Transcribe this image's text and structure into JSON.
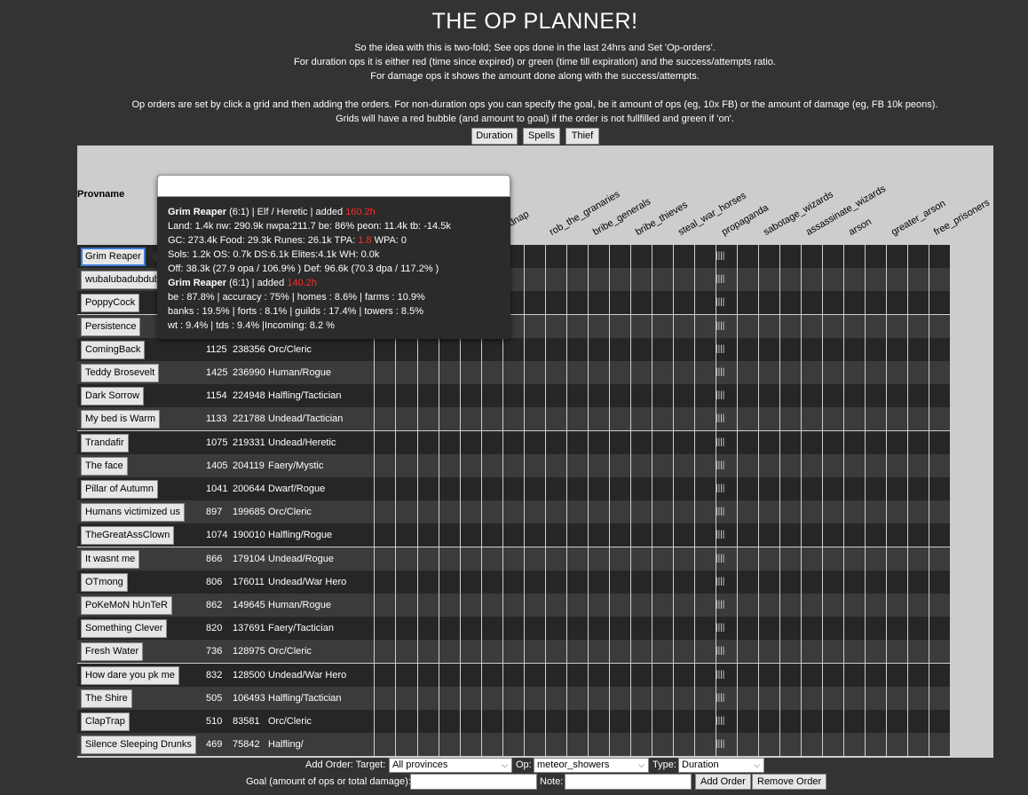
{
  "page": {
    "title": "THE OP PLANNER!",
    "intro": [
      "So the idea with this is two-fold; See ops done in the last 24hrs and Set 'Op-orders'.",
      "For duration ops it is either red (time since expired) or green (time till expiration) and the success/attempts ratio.",
      "For damage ops it shows the amount done along with the success/attempts.",
      "Op orders are set by click a grid and then adding the orders. For non-duration ops you can specify the goal, be it amount of ops (eg, 10x FB) or the amount of damage (eg, FB 10k peons).",
      "Grids will have a red bubble (and amount to goal) if the order is not fullfilled and green if 'on'."
    ]
  },
  "mode_buttons": [
    "Duration",
    "Spells",
    "Thief"
  ],
  "grid": {
    "provname_header": "Provname",
    "ops_columns": [
      "kidnap",
      "rob_the_granaries",
      "bribe_generals",
      "bribe_thieves",
      "steal_war_horses",
      "propaganda",
      "sabotage_wizards",
      "assassinate_wizards",
      "arson",
      "greater_arson",
      "free_prisoners"
    ],
    "tick_mark": "||||",
    "rows": [
      {
        "name": "Grim Reaper",
        "acres": "",
        "nw": "",
        "race_class": ""
      },
      {
        "name": "wubalubadubdub",
        "acres": "",
        "nw": "",
        "race_class": ""
      },
      {
        "name": "PoppyCock",
        "acres": "",
        "nw": "",
        "race_class": ""
      },
      {
        "name": "Persistence",
        "acres": "",
        "nw": "",
        "race_class": ""
      },
      {
        "name": "ComingBack",
        "acres": "1125",
        "nw": "238356",
        "race_class": "Orc/Cleric"
      },
      {
        "name": "Teddy Brosevelt",
        "acres": "1425",
        "nw": "236990",
        "race_class": "Human/Rogue"
      },
      {
        "name": "Dark Sorrow",
        "acres": "1154",
        "nw": "224948",
        "race_class": "Halfling/Tactician"
      },
      {
        "name": "My bed is Warm",
        "acres": "1133",
        "nw": "221788",
        "race_class": "Undead/Tactician"
      },
      {
        "name": "Trandafir",
        "acres": "1075",
        "nw": "219331",
        "race_class": "Undead/Heretic"
      },
      {
        "name": "The face",
        "acres": "1405",
        "nw": "204119",
        "race_class": "Faery/Mystic"
      },
      {
        "name": "Pillar of Autumn",
        "acres": "1041",
        "nw": "200644",
        "race_class": "Dwarf/Rogue"
      },
      {
        "name": "Humans victimized us",
        "acres": "897",
        "nw": "199685",
        "race_class": "Orc/Cleric"
      },
      {
        "name": "TheGreatAssClown",
        "acres": "1074",
        "nw": "190010",
        "race_class": "Halfling/Rogue"
      },
      {
        "name": "It wasnt me",
        "acres": "866",
        "nw": "179104",
        "race_class": "Undead/Rogue"
      },
      {
        "name": "OTmong",
        "acres": "806",
        "nw": "176011",
        "race_class": "Undead/War Hero"
      },
      {
        "name": "PoKeMoN hUnTeR",
        "acres": "862",
        "nw": "149645",
        "race_class": "Human/Rogue"
      },
      {
        "name": "Something Clever",
        "acres": "820",
        "nw": "137691",
        "race_class": "Faery/Tactician"
      },
      {
        "name": "Fresh Water",
        "acres": "736",
        "nw": "128975",
        "race_class": "Orc/Cleric"
      },
      {
        "name": "How dare you pk me",
        "acres": "832",
        "nw": "128500",
        "race_class": "Undead/War Hero"
      },
      {
        "name": "The Shire",
        "acres": "505",
        "nw": "106493",
        "race_class": "Halfling/Tactician"
      },
      {
        "name": "ClapTrap",
        "acres": "510",
        "nw": "83581",
        "race_class": "Orc/Cleric"
      },
      {
        "name": "Silence Sleeping Drunks",
        "acres": "469",
        "nw": "75842",
        "race_class": "Halfling/"
      }
    ]
  },
  "tooltip": {
    "input_value": "",
    "head_name": "Grim Reaper",
    "head_rest": " (6:1) | Elf / Heretic | added ",
    "head_added": "160.2h",
    "line2": "Land: 1.4k nw: 290.9k nwpa:211.7 be: 86% peon: 11.4k tb: -14.5k",
    "line3_pre": "GC: 273.4k Food: 29.3k Runes: 26.1k TPA: ",
    "line3_red": "1.8",
    "line3_post": " WPA: 0",
    "line4": "Sols: 1.2k OS: 0.7k DS:6.1k Elites:4.1k WH: 0.0k",
    "line5": "Off: 38.3k (27.9 opa / 106.9% ) Def: 96.6k (70.3 dpa / 117.2% )",
    "sub_name": "Grim Reaper",
    "sub_rest": " (6:1) | added ",
    "sub_added": "140.2h",
    "line7": "be : 87.8% | accuracy : 75% | homes : 8.6% | farms : 10.9%",
    "line8": "banks : 19.5% | forts : 8.1% | guilds : 17.4% | towers : 8.5%",
    "line9": "wt : 9.4% | tds : 9.4% |Incoming: 8.2 %"
  },
  "order_form": {
    "add_order_label": "Add Order: Target:",
    "target_value": "All provinces",
    "op_label": "Op:",
    "op_value": "meteor_showers",
    "type_label": "Type:",
    "type_value": "Duration",
    "goal_label": "Goal (amount of ops or total damage):",
    "goal_value": "",
    "note_label": "Note:",
    "note_value": "",
    "add_button": "Add Order",
    "remove_button": "Remove Order"
  }
}
